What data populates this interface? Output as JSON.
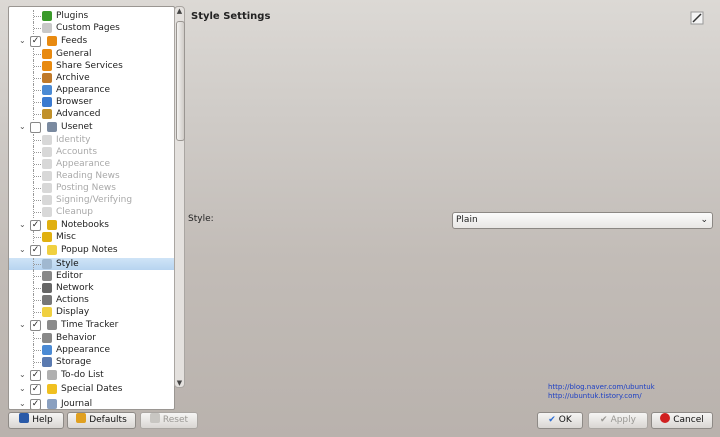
{
  "sidebar": {
    "items": [
      {
        "label": "Plugins",
        "type": "child",
        "icon": "puzzle-icon",
        "color": "#3a9a2a"
      },
      {
        "label": "Custom Pages",
        "type": "child",
        "icon": "wand-icon",
        "color": "#c8c8c8"
      },
      {
        "label": "Feeds",
        "type": "cat",
        "icon": "feeds-icon",
        "color": "#e88a10",
        "checked": true
      },
      {
        "label": "General",
        "type": "child",
        "icon": "feeds-icon",
        "color": "#e88a10"
      },
      {
        "label": "Share Services",
        "type": "child",
        "icon": "feeds-icon",
        "color": "#e88a10"
      },
      {
        "label": "Archive",
        "type": "child",
        "icon": "archive-icon",
        "color": "#c07a2a"
      },
      {
        "label": "Appearance",
        "type": "child",
        "icon": "appearance-icon",
        "color": "#4a8ad4"
      },
      {
        "label": "Browser",
        "type": "child",
        "icon": "globe-icon",
        "color": "#3a7ad0"
      },
      {
        "label": "Advanced",
        "type": "child",
        "icon": "toolbox-icon",
        "color": "#c0902a"
      },
      {
        "label": "Usenet",
        "type": "cat",
        "icon": "usenet-icon",
        "color": "#7a8aa0",
        "checked": false
      },
      {
        "label": "Identity",
        "type": "child",
        "icon": "identity-icon",
        "color": "#d8d8d8",
        "disabled": true
      },
      {
        "label": "Accounts",
        "type": "child",
        "icon": "accounts-icon",
        "color": "#d8d8d8",
        "disabled": true
      },
      {
        "label": "Appearance",
        "type": "child",
        "icon": "appearance-icon",
        "color": "#d8d8d8",
        "disabled": true
      },
      {
        "label": "Reading News",
        "type": "child",
        "icon": "reading-icon",
        "color": "#d8d8d8",
        "disabled": true
      },
      {
        "label": "Posting News",
        "type": "child",
        "icon": "posting-icon",
        "color": "#d8d8d8",
        "disabled": true
      },
      {
        "label": "Signing/Verifying",
        "type": "child",
        "icon": "lock-icon",
        "color": "#d8d8d8",
        "disabled": true
      },
      {
        "label": "Cleanup",
        "type": "child",
        "icon": "cleanup-icon",
        "color": "#d8d8d8",
        "disabled": true
      },
      {
        "label": "Notebooks",
        "type": "cat",
        "icon": "notebooks-icon",
        "color": "#e0b010",
        "checked": true
      },
      {
        "label": "Misc",
        "type": "child",
        "icon": "misc-icon",
        "color": "#e0b010"
      },
      {
        "label": "Popup Notes",
        "type": "cat",
        "icon": "popup-notes-icon",
        "color": "#f0d040",
        "checked": true
      },
      {
        "label": "Style",
        "type": "child",
        "icon": "style-icon",
        "color": "#a0b8d0",
        "selected": true
      },
      {
        "label": "Editor",
        "type": "child",
        "icon": "editor-icon",
        "color": "#888888"
      },
      {
        "label": "Network",
        "type": "child",
        "icon": "network-icon",
        "color": "#666666"
      },
      {
        "label": "Actions",
        "type": "child",
        "icon": "actions-icon",
        "color": "#777777"
      },
      {
        "label": "Display",
        "type": "child",
        "icon": "display-icon",
        "color": "#f0d040"
      },
      {
        "label": "Time Tracker",
        "type": "cat",
        "icon": "clock-icon",
        "color": "#8a8a8a",
        "checked": true
      },
      {
        "label": "Behavior",
        "type": "child",
        "icon": "behavior-icon",
        "color": "#888888"
      },
      {
        "label": "Appearance",
        "type": "child",
        "icon": "appearance-icon",
        "color": "#4a8ad4"
      },
      {
        "label": "Storage",
        "type": "child",
        "icon": "storage-icon",
        "color": "#5a7ab0"
      },
      {
        "label": "To-do List",
        "type": "cat",
        "icon": "todo-icon",
        "color": "#b0b0b0",
        "checked": true
      },
      {
        "label": "Special Dates",
        "type": "cat",
        "icon": "star-icon",
        "color": "#f0c020",
        "checked": true
      },
      {
        "label": "Journal",
        "type": "cat",
        "icon": "journal-icon",
        "color": "#8aa0c0",
        "checked": true
      }
    ]
  },
  "page": {
    "title": "Style Settings",
    "style_label": "Style:",
    "style_value": "Plain",
    "links": [
      "http://blog.naver.com/ubuntuk",
      "http://ubuntuk.tistory.com/"
    ]
  },
  "buttons": {
    "help": "Help",
    "defaults": "Defaults",
    "reset": "Reset",
    "ok": "OK",
    "apply": "Apply",
    "cancel": "Cancel"
  },
  "colors": {
    "ok_icon": "#2a6ad0",
    "cancel_icon": "#d02020",
    "selection": "#b7d4f0"
  }
}
